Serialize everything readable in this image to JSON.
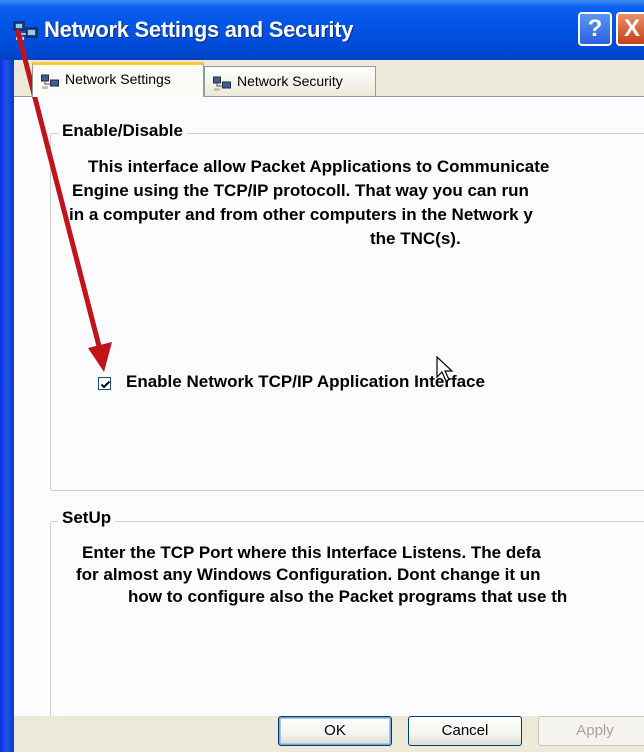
{
  "window": {
    "title": "Network Settings and Security",
    "help_label": "?",
    "close_label": "X"
  },
  "tabs": [
    {
      "label": "Network Settings",
      "icon": "network-icon",
      "active": true
    },
    {
      "label": "Network Security",
      "icon": "network-icon",
      "active": false
    }
  ],
  "enable_group": {
    "legend": "Enable/Disable",
    "description_lines": [
      "This interface allow Packet Applications to Communicate",
      "Engine using the TCP/IP protocoll. That way you can run",
      "in a computer and from other computers in the Network y",
      "the TNC(s)."
    ],
    "checkbox_label": "Enable Network TCP/IP Application Interface",
    "checkbox_checked": true
  },
  "setup_group": {
    "legend": "SetUp",
    "description_lines": [
      "Enter the TCP Port where this Interface Listens. The defa",
      "for almost any Windows Configuration. Dont change it un",
      "how to configure also the Packet programs that use th"
    ]
  },
  "buttons": {
    "ok": "OK",
    "cancel": "Cancel",
    "apply": "Apply"
  },
  "colors": {
    "titlebar": "#0054e3",
    "annotation_arrow": "#c0141c",
    "active_tab_highlight": "#ffc83c"
  }
}
